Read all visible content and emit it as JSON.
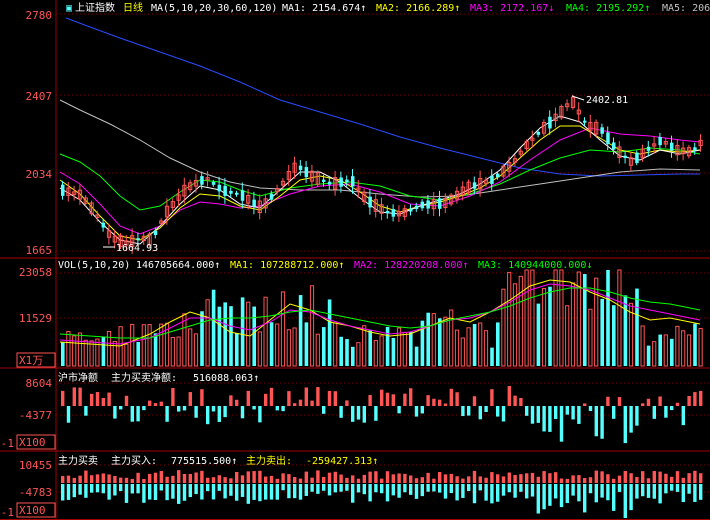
{
  "colors": {
    "up": "#ff5555",
    "down": "#54ffff",
    "axis": "#a00000",
    "grid": "#7a0000",
    "white": "#ffffff",
    "ma_white": "#ffffff",
    "ma_yellow": "#ffff00",
    "ma_magenta": "#ff00ff",
    "ma_green": "#00ff00",
    "ma_blue": "#2a4cff",
    "ma_silver": "#c0c0c0",
    "text_red": "#ff6666"
  },
  "price_pane": {
    "title": "上证指数",
    "period": "日线",
    "ma_header": "MA(5,10,20,30,60,120)",
    "ma_values": [
      {
        "label": "MA1: 2154.674↑",
        "color": "#ffffff"
      },
      {
        "label": "MA2: 2166.289↑",
        "color": "#ffff00"
      },
      {
        "label": "MA3: 2172.167↓",
        "color": "#ff00ff"
      },
      {
        "label": "MA4: 2195.292↑",
        "color": "#00ff00"
      },
      {
        "label": "MA5: 206",
        "color": "#c0c0c0"
      }
    ],
    "y_labels": [
      "2780",
      "2407",
      "2034",
      "1665"
    ],
    "low_annotation": "1664.93",
    "high_annotation": "2402.81"
  },
  "volume_pane": {
    "header": "VOL(5,10,20)",
    "vol_value": "146705664.000↑",
    "ma_values": [
      {
        "label": "MA1: 107288712.000↑",
        "color": "#ffff00"
      },
      {
        "label": "MA2: 128220208.000↑",
        "color": "#ff00ff"
      },
      {
        "label": "MA3: 140944000.000↓",
        "color": "#00ff00"
      }
    ],
    "y_labels": [
      "23058",
      "11529"
    ],
    "unit": "X1万"
  },
  "netflow_pane": {
    "title": "沪市净额",
    "label": "主力买卖净额:",
    "value": "516088.063↑",
    "y_labels": [
      "8604",
      "-4377",
      "-1"
    ],
    "unit": "X100"
  },
  "mainforce_pane": {
    "title": "主力买卖",
    "buy_label": "主力买入:",
    "buy_value": "775515.500↑",
    "sell_label": "主力卖出:",
    "sell_value": "-259427.313↑",
    "y_labels": [
      "10455",
      "-4783",
      "-1"
    ],
    "unit": "X100"
  }
}
